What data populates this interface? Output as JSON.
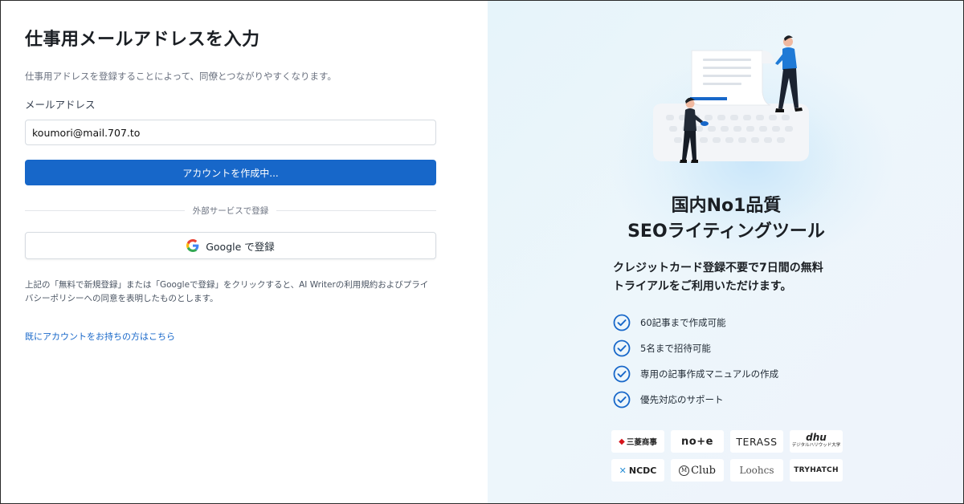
{
  "form": {
    "title": "仕事用メールアドレスを入力",
    "subtitle": "仕事用アドレスを登録することによって、同僚とつながりやすくなります。",
    "email_label": "メールアドレス",
    "email_value": "koumori@mail.707.to",
    "submit_label": "アカウントを作成中...",
    "divider_text": "外部サービスで登録",
    "google_label": "Google で登録",
    "terms": "上記の「無料で新規登録」または「Googleで登録」をクリックすると、AI Writerの利用規約およびプライバシーポリシーへの同意を表明したものとします。",
    "login_link": "既にアカウントをお持ちの方はこちら"
  },
  "promo": {
    "headline_line1": "国内No1品質",
    "headline_line2": "SEOライティングツール",
    "text_line1": "クレジットカード登録不要で7日間の無料",
    "text_line2": "トライアルをご利用いただけます。",
    "features": [
      "60記事まで作成可能",
      "5名まで招待可能",
      "専用の記事作成マニュアルの作成",
      "優先対応のサポート"
    ],
    "logos": {
      "mitsubishi": "三菱商事",
      "note": "no+e",
      "terass": "TERASS",
      "dhu": "dhu",
      "dhu_sub": "デジタルハリウッド大学",
      "ncdc": "NCDC",
      "club": "Club",
      "club_mark": "M",
      "loohcs": "Loohcs",
      "tryhatch": "TRYHATCH"
    }
  },
  "colors": {
    "primary": "#1767c9",
    "check": "#1767c9",
    "right_bg": "#e6f4fa"
  },
  "icons": {
    "google": "google-g-icon",
    "check": "check-circle-icon"
  }
}
